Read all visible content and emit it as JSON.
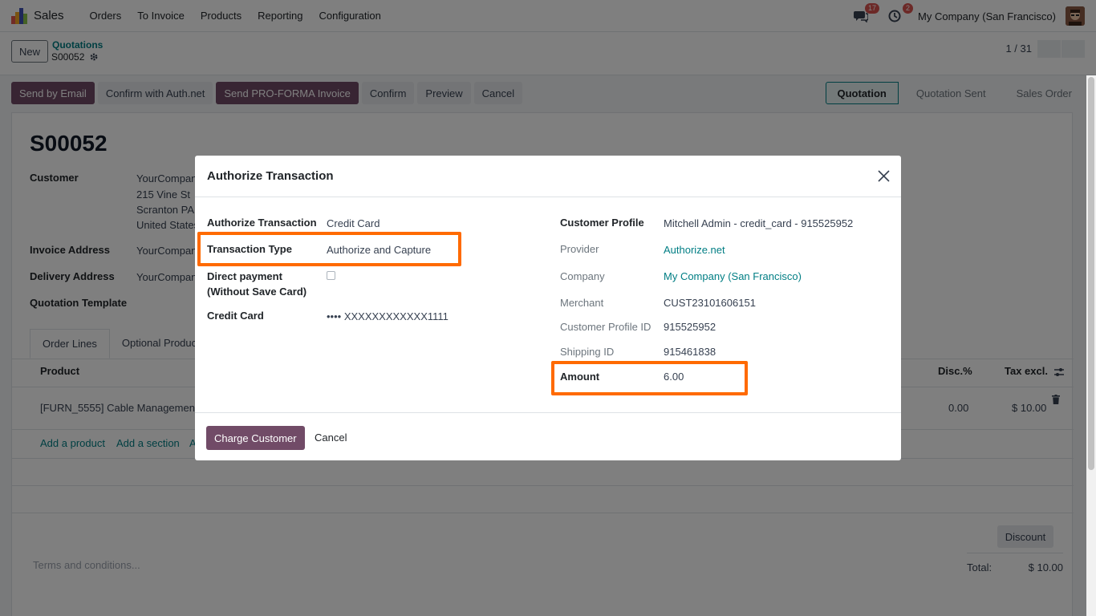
{
  "app": {
    "name": "Sales"
  },
  "nav": {
    "items": [
      "Orders",
      "To Invoice",
      "Products",
      "Reporting",
      "Configuration"
    ]
  },
  "systray": {
    "messages_badge": "17",
    "activity_badge": "2",
    "company": "My Company (San Francisco)"
  },
  "control": {
    "new_label": "New",
    "breadcrumb_parent": "Quotations",
    "breadcrumb_current": "S00052",
    "pager": "1 / 31"
  },
  "actions": {
    "send_email": "Send by Email",
    "confirm_auth": "Confirm with Auth.net",
    "send_proforma": "Send PRO-FORMA Invoice",
    "confirm": "Confirm",
    "preview": "Preview",
    "cancel": "Cancel"
  },
  "status": {
    "stages": [
      "Quotation",
      "Quotation Sent",
      "Sales Order"
    ],
    "active": "Quotation"
  },
  "form": {
    "title": "S00052",
    "customer_label": "Customer",
    "customer_lines": [
      "YourCompan",
      "215 Vine St",
      "Scranton PA",
      "United States"
    ],
    "invoice_label": "Invoice Address",
    "invoice_value": "YourCompan",
    "delivery_label": "Delivery Address",
    "delivery_value": "YourCompan",
    "template_label": "Quotation Template",
    "tabs": [
      "Order Lines",
      "Optional Produc"
    ],
    "columns": {
      "product": "Product",
      "disc": "Disc.%",
      "tax": "Tax excl."
    },
    "line": {
      "product": "[FURN_5555] Cable Management",
      "disc": "0.00",
      "tax": "$ 10.00"
    },
    "add_product": "Add a product",
    "add_section": "Add a section",
    "add_note": "A",
    "terms_placeholder": "Terms and conditions...",
    "discount": "Discount",
    "total_label": "Total:",
    "total_value": "$ 10.00"
  },
  "modal": {
    "title": "Authorize Transaction",
    "left": {
      "auth_label": "Authorize Transaction",
      "auth_value": "Credit Card",
      "type_label": "Transaction Type",
      "type_value": "Authorize and Capture",
      "direct_label_1": "Direct payment",
      "direct_label_2": "(Without Save Card)",
      "card_label": "Credit Card",
      "card_value": "•••• XXXXXXXXXXXX1111"
    },
    "right": {
      "profile_label": "Customer Profile",
      "profile_value": "Mitchell Admin - credit_card - 915525952",
      "provider_label": "Provider",
      "provider_value": "Authorize.net",
      "company_label": "Company",
      "company_value": "My Company (San Francisco)",
      "merchant_label": "Merchant",
      "merchant_value": "CUST23101606151",
      "profile_id_label": "Customer Profile ID",
      "profile_id_value": "915525952",
      "shipping_label": "Shipping ID",
      "shipping_value": "915461838",
      "amount_label": "Amount",
      "amount_value": "6.00"
    },
    "footer": {
      "charge": "Charge Customer",
      "cancel": "Cancel"
    }
  },
  "colors": {
    "brand": "#714b67",
    "link": "#017e84",
    "highlight": "#ff6a00"
  }
}
